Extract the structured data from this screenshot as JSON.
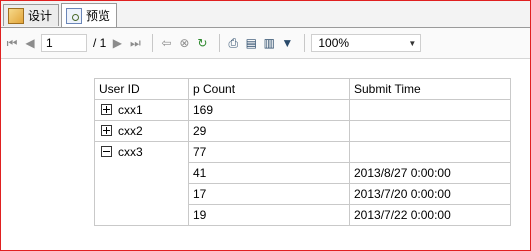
{
  "tabs": [
    {
      "label": "设计",
      "icon": "design-icon",
      "active": false
    },
    {
      "label": "预览",
      "icon": "preview-icon",
      "active": true
    }
  ],
  "toolbar": {
    "page_value": "1",
    "page_of": "/ 1",
    "zoom": "100%",
    "icons": [
      "first-page-icon",
      "prev-page-icon",
      "next-page-icon",
      "last-page-icon",
      "back-icon",
      "stop-icon",
      "refresh-icon",
      "print-icon",
      "page-layout-icon",
      "page-setup-icon",
      "export-icon"
    ]
  },
  "table": {
    "headers": [
      "User ID",
      "p Count",
      "Submit Time"
    ],
    "groups": [
      {
        "user": "cxx1",
        "count": "169",
        "expanded": false,
        "rows": []
      },
      {
        "user": "cxx2",
        "count": "29",
        "expanded": false,
        "rows": []
      },
      {
        "user": "cxx3",
        "count": "77",
        "expanded": true,
        "rows": [
          {
            "count": "41",
            "time": "2013/8/27 0:00:00"
          },
          {
            "count": "17",
            "time": "2013/7/20 0:00:00"
          },
          {
            "count": "19",
            "time": "2013/7/22 0:00:00"
          }
        ]
      }
    ]
  },
  "colors": {
    "frame": "#e02020",
    "grid": "#c9c9c9"
  }
}
